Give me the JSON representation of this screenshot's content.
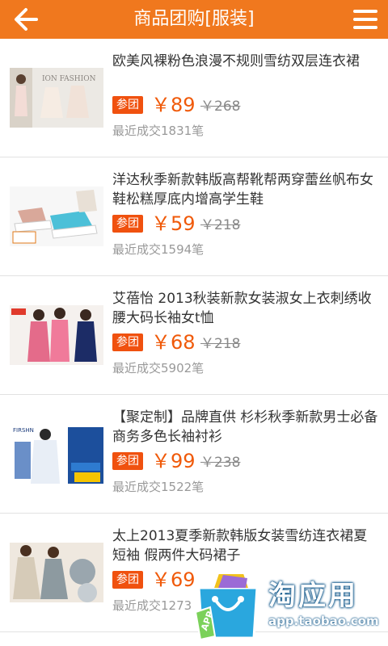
{
  "header": {
    "title": "商品团购[服装]",
    "back_icon": "back-arrow-icon",
    "menu_icon": "menu-icon",
    "color": "#f0781e"
  },
  "items": [
    {
      "name": "欧美风裸粉色浪漫不规则雪纺双层连衣裙",
      "badge": "参团",
      "price": "￥89",
      "original": "￥268",
      "sold": "最近成交1831笔",
      "image_text": "ION FASHION"
    },
    {
      "name": "洋达秋季新款韩版高帮靴帮两穿蕾丝帆布女鞋松糕厚底内增高学生鞋",
      "badge": "参团",
      "price": "￥59",
      "original": "￥218",
      "sold": "最近成交1594笔",
      "image_text": ""
    },
    {
      "name": "艾蓓怡 2013秋装新款女装淑女上衣刺绣收腰大码长袖女t恤",
      "badge": "参团",
      "price": "￥68",
      "original": "￥218",
      "sold": "最近成交5902笔",
      "image_text": ""
    },
    {
      "name": "【聚定制】品牌直供 杉杉秋季新款男士必备商务多色长袖衬衫",
      "badge": "参团",
      "price": "￥99",
      "original": "￥238",
      "sold": "最近成交1522笔",
      "image_text": "FIRSHN"
    },
    {
      "name": "太上2013夏季新款韩版女装雪纺连衣裙夏短袖 假两件大码裙子",
      "badge": "参团",
      "price": "￥69",
      "original": "",
      "sold": "最近成交1273",
      "image_text": ""
    }
  ],
  "watermark": {
    "title": "淘应用",
    "url": "app.taobao.com",
    "badge": "APP"
  },
  "colors": {
    "accent": "#f0781e",
    "price": "#f05a0a",
    "badge": "#f0510f"
  }
}
